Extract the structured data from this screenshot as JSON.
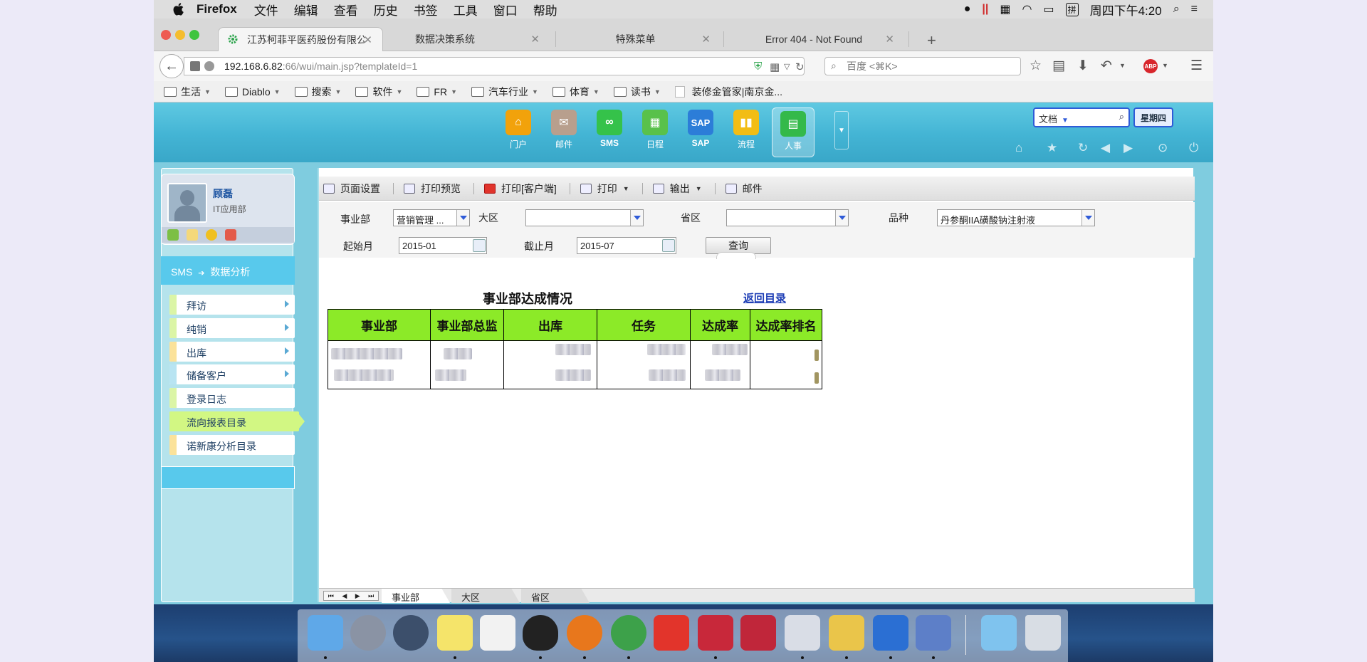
{
  "menubar": {
    "app_name": "Firefox",
    "menus": [
      "文件",
      "编辑",
      "查看",
      "历史",
      "书签",
      "工具",
      "窗口",
      "帮助"
    ],
    "clock": "周四下午4:20",
    "input_method": "拼"
  },
  "browser": {
    "tabs": [
      {
        "title": "江苏柯菲平医药股份有限公...",
        "active": true
      },
      {
        "title": "数据决策系统",
        "active": false
      },
      {
        "title": "特殊菜单",
        "active": false
      },
      {
        "title": "Error 404 - Not Found",
        "active": false
      }
    ],
    "url_host": "192.168.6.82",
    "url_rest": ":66/wui/main.jsp?templateId=1",
    "search_placeholder": "百度 <⌘K>",
    "abp_label": "ABP",
    "bookmarks": [
      {
        "label": "生活",
        "type": "folder"
      },
      {
        "label": "Diablo",
        "type": "folder"
      },
      {
        "label": "搜索",
        "type": "folder"
      },
      {
        "label": "软件",
        "type": "folder"
      },
      {
        "label": "FR",
        "type": "folder"
      },
      {
        "label": "汽车行业",
        "type": "folder"
      },
      {
        "label": "体育",
        "type": "folder"
      },
      {
        "label": "读书",
        "type": "folder"
      },
      {
        "label": "装修金管家|南京金...",
        "type": "page"
      }
    ]
  },
  "oa": {
    "modules": [
      {
        "label": "门户",
        "color": "#f2a20b",
        "icon": "home-icon"
      },
      {
        "label": "邮件",
        "color": "#b89f8d",
        "icon": "mail-icon"
      },
      {
        "label": "SMS",
        "color": "#35c24a",
        "icon": "sms-icon"
      },
      {
        "label": "日程",
        "color": "#59c14b",
        "icon": "calendar-icon"
      },
      {
        "label": "SAP",
        "color": "#2c7dd8",
        "icon": "sap-icon"
      },
      {
        "label": "流程",
        "color": "#f2bd14",
        "icon": "flow-icon"
      },
      {
        "label": "人事",
        "color": "#34b94a",
        "icon": "hr-icon"
      }
    ],
    "header_search_scope": "文档",
    "weekday": "星期四",
    "user": {
      "name": "顾磊",
      "dept": "IT应用部"
    },
    "section_title": "SMS",
    "section_sub": "数据分析",
    "nav": [
      {
        "label": "拜访",
        "bar": "#dbf5a6",
        "has_arrow": true
      },
      {
        "label": "纯销",
        "bar": "#dbf5a6",
        "has_arrow": true
      },
      {
        "label": "出库",
        "bar": "#fbe29a",
        "has_arrow": true
      },
      {
        "label": "储备客户",
        "bar": "#b8e4f2",
        "has_arrow": true
      },
      {
        "label": "登录日志",
        "bar": "#dbf5a6",
        "has_arrow": false
      },
      {
        "label": "流向报表目录",
        "bar": "#d2f783",
        "has_arrow": false
      },
      {
        "label": "诺新康分析目录",
        "bar": "#fbe29a",
        "has_arrow": false
      }
    ]
  },
  "report": {
    "toolbar": [
      "页面设置",
      "打印预览",
      "打印[客户端]",
      "打印",
      "输出",
      "邮件"
    ],
    "filters": {
      "division_label": "事业部",
      "division_value": "营销管理 ...",
      "region_label": "大区",
      "region_value": "",
      "province_label": "省区",
      "province_value": "",
      "product_label": "品种",
      "product_value": "丹参酮IIA磺酸钠注射液",
      "start_label": "起始月",
      "start_value": "2015-01",
      "end_label": "截止月",
      "end_value": "2015-07",
      "query_label": "查询"
    },
    "title": "事业部达成情况",
    "back_link": "返回目录",
    "columns": [
      "事业部",
      "事业部总监",
      "出库",
      "任务",
      "达成率",
      "达成率排名"
    ],
    "sheets": [
      "事业部",
      "大区",
      "省区"
    ]
  },
  "dock": {
    "apps": [
      {
        "name": "finder-icon",
        "color": "#5fa8e8"
      },
      {
        "name": "launchpad-icon",
        "color": "#8a93a4"
      },
      {
        "name": "quicktime-icon",
        "color": "#3c4f6b"
      },
      {
        "name": "notes-icon",
        "color": "#f5e46a"
      },
      {
        "name": "reminders-icon",
        "color": "#f2f2f2"
      },
      {
        "name": "qq-icon",
        "color": "#222222"
      },
      {
        "name": "firefox-icon",
        "color": "#e8771c"
      },
      {
        "name": "chrome-icon",
        "color": "#3da14a"
      },
      {
        "name": "app-g-icon",
        "color": "#e2342b"
      },
      {
        "name": "parallels-icon",
        "color": "#c8283a"
      },
      {
        "name": "app-m-icon",
        "color": "#c0263a"
      },
      {
        "name": "window-app-icon",
        "color": "#d9dde6"
      },
      {
        "name": "folder-app-icon",
        "color": "#eac54a"
      },
      {
        "name": "app-f-icon",
        "color": "#2b6fd3"
      },
      {
        "name": "remote-desktop-icon",
        "color": "#5d7fc8"
      },
      {
        "name": "downloads-folder-icon",
        "color": "#7fc3ee"
      },
      {
        "name": "trash-icon",
        "color": "#d8dde4"
      }
    ]
  }
}
